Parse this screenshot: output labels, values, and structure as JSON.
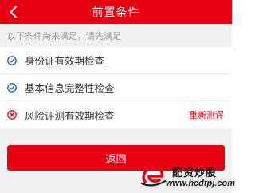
{
  "colors": {
    "brand_red": "#e60012",
    "check_blue": "#1a5fb4",
    "fail_red": "#e60012",
    "muted_text": "#999999",
    "background_gray": "#f1f1f3"
  },
  "header": {
    "back_icon": "chevron-left-icon",
    "title": "前置条件"
  },
  "notice": {
    "text": "以下条件尚未满足，请先满足"
  },
  "checks": [
    {
      "label": "身份证有效期检查",
      "status": "passed",
      "icon": "check-circle-icon"
    },
    {
      "label": "基本信息完整性检查",
      "status": "passed",
      "icon": "check-circle-icon"
    },
    {
      "label": "风险评测有效期检查",
      "status": "failed",
      "icon": "x-circle-icon",
      "action_label": "重新测评"
    }
  ],
  "footer": {
    "return_label": "返回"
  },
  "watermark": {
    "name": "配资炒股",
    "url": "www.hcdtpj.com"
  }
}
